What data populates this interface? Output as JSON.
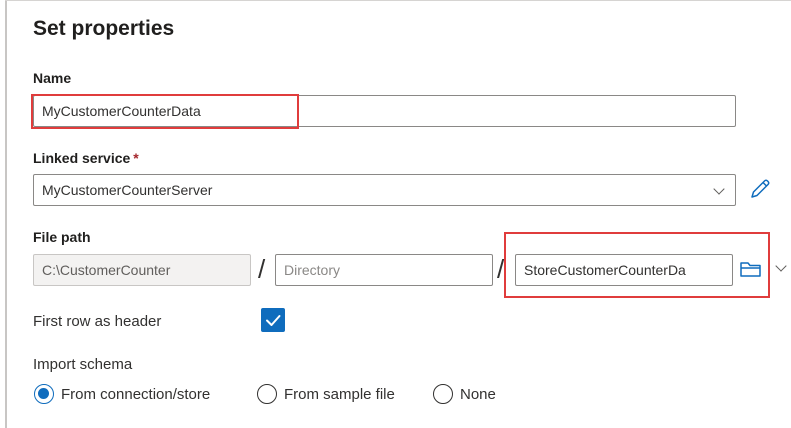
{
  "panel": {
    "title": "Set properties"
  },
  "name": {
    "label": "Name",
    "value": "MyCustomerCounterData"
  },
  "linked_service": {
    "label": "Linked service",
    "required_mark": "*",
    "value": "MyCustomerCounterServer"
  },
  "file_path": {
    "label": "File path",
    "container": "C:\\CustomerCounter",
    "separator": "/",
    "directory_placeholder": "Directory",
    "file_name": "StoreCustomerCounterDa"
  },
  "first_row_header": {
    "label": "First row as header",
    "checked": true
  },
  "import_schema": {
    "label": "Import schema",
    "options": [
      "From connection/store",
      "From sample file",
      "None"
    ],
    "selected": "From connection/store"
  },
  "colors": {
    "accent": "#0f6cbd",
    "highlight": "#e03c3c"
  },
  "icons": [
    "chevron-down-icon",
    "pencil-icon",
    "folder-icon",
    "checkmark-icon"
  ]
}
